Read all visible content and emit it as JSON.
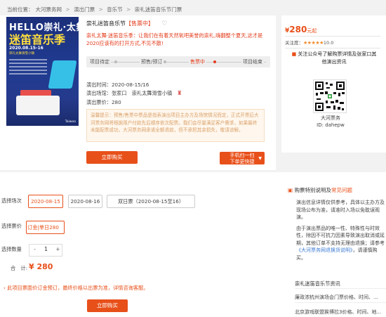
{
  "breadcrumb": {
    "prefix": "当前位置：",
    "items": [
      "大河票务网",
      "演出门票",
      "音乐节",
      "崇礼迷笛音乐节门票"
    ],
    "sep": ">"
  },
  "poster": {
    "line1": "HELLO崇礼·太舞",
    "line2": "迷笛音乐季",
    "date": "2020.08.15-16",
    "venue": "崇礼太舞滑雪小镇",
    "logo": "Taiwoo"
  },
  "event": {
    "title": "崇礼迷笛音乐节",
    "status": "【售票中】",
    "description": "崇礼太舞·迷笛音乐季：让我们在有着天然氧吧美誉的崇礼,嗨翻整个夏天,这才是2020应该有的打开方式,不见不散!",
    "steps": [
      "项目待定",
      "预售/预订",
      "售票中",
      "项目结束"
    ],
    "active_step": 2,
    "time_label": "演出时间：",
    "time_value": "2020-08-15/16",
    "venue_label": "演出场馆：",
    "venue_value": "张家口　崇礼太舞滑雪小镇",
    "price_label": "演出票价：",
    "price_value": "280",
    "notice": "温馨提示：预售/售票中票品是指表演出项目主办方及场馆情况而定，正式开票后大河票务网将根据用户付款先后顺序依次配票。我们会尽量满足客户需求，如果最终未能配票成功，大河票务网承诺全额退款，但不承担其余损失，敬请谅解。",
    "buy_label": "立即购买",
    "mobile_label_1": "手机扫一扫",
    "mobile_label_2": "下单更快捷"
  },
  "side": {
    "price": "280",
    "price_prefix": "¥",
    "price_unit": "元起",
    "attention_label": "关注度：",
    "stars": "★★★★★",
    "rating": "10.0",
    "wechat_text": "关注公众号了解购票详情及张家口其他演出资讯",
    "qr_name": "大河票务",
    "qr_id": "ID: dahepw"
  },
  "order": {
    "session_label": "选择场次",
    "sessions": [
      "2020-08-15",
      "2020-08-16",
      "双日票（2020-08-15至16）"
    ],
    "selected_session": 0,
    "price_label": "选择票价",
    "price_option": "订金|单日280",
    "qty_label": "选择数量",
    "qty_minus": "-",
    "qty_value": "1",
    "qty_plus": "+",
    "total_label": "合　计:",
    "total_value": "¥ 280",
    "warning": "此项目票面价订金预订，最终价格以出票为准，详情咨询客服。",
    "buy_label": "立即购买"
  },
  "notes": {
    "title_prefix": "购票特别说明及",
    "title_link": "常见问题",
    "p1": "演出信息详情仅供参考，具体以主办方及现场公布为准，请准时入场以免耽误观演。",
    "p2": "由于演出票品的唯一性、特殊性与时效性，除因不可抗力因素导致演出取消或延期，其他订单不支持无理由退换；请参考",
    "p2_link": "《大河票务网退换货说明》",
    "p2_end": "，请谨慎购买。",
    "related_title": "崇礼迷笛音乐节资讯",
    "related": [
      "廉政浓杭州演场会门票价格、时间、...",
      "北京游戏联盟挨博拉3价格、时间、地..."
    ]
  }
}
